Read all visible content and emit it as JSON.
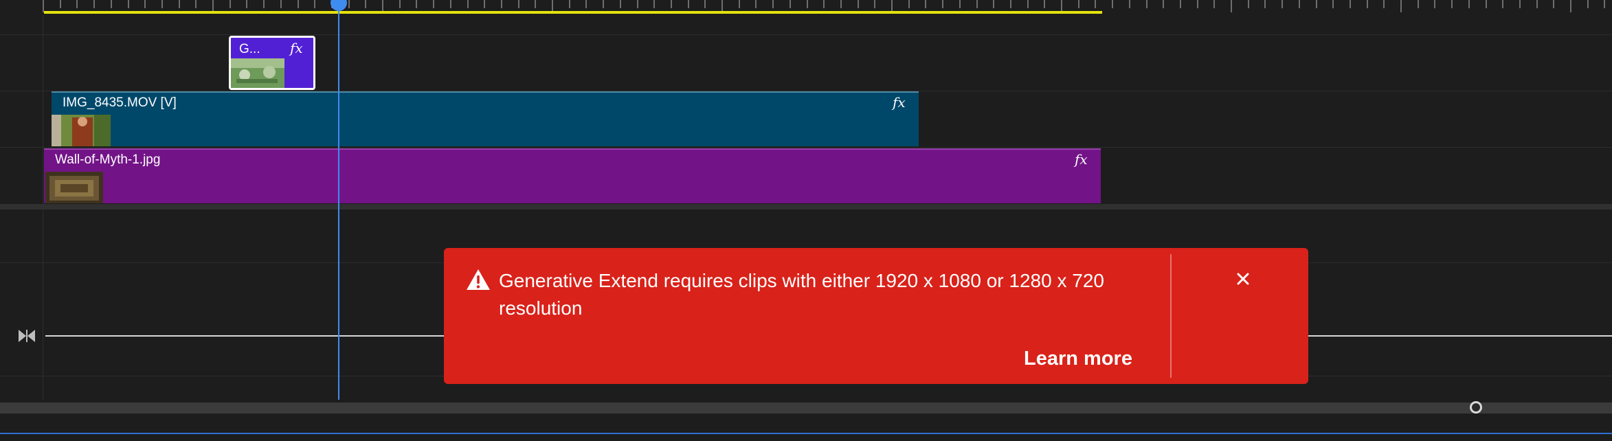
{
  "timeline": {
    "clips": [
      {
        "label": "G...",
        "fx": "fx",
        "color": "#5220d4"
      },
      {
        "label": "IMG_8435.MOV [V]",
        "fx": "fx",
        "color": "#00486a"
      },
      {
        "label": "Wall-of-Myth-1.jpg",
        "fx": "fx",
        "color": "#721487"
      }
    ],
    "colors": {
      "work_area": "#e4e20e",
      "playhead": "#3f8cf0",
      "background": "#1d1d1d"
    },
    "icons": [
      "playhead-handle-icon",
      "bowtie-icon",
      "scroll-zoom-knob-icon"
    ]
  },
  "toast": {
    "message": "Generative Extend requires clips with either 1920 x 1080 or 1280 x 720 resolution",
    "learn_more": "Learn more",
    "icons": [
      "warning-icon",
      "close-icon"
    ],
    "color": "#d9221a"
  }
}
